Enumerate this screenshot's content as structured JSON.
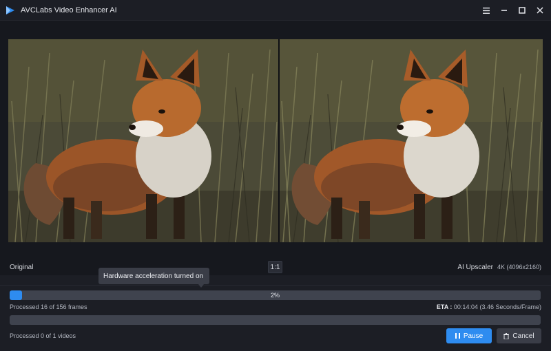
{
  "window": {
    "title": "AVCLabs Video Enhancer AI",
    "controls": [
      "menu-icon",
      "minimize-icon",
      "maximize-icon",
      "close-icon"
    ]
  },
  "preview": {
    "left_label": "Original",
    "ratio_label": "1:1",
    "model_label": "AI Upscaler",
    "resolution_label": "4K (4096x2160)"
  },
  "tooltip": {
    "text": "Hardware acceleration turned on"
  },
  "progress": {
    "percent_label": "2%",
    "fraction": 0.02,
    "frames_text": "Processed 16 of 156 frames",
    "eta_label": "ETA :",
    "eta_value": "00:14:04 (3.46 Seconds/Frame)"
  },
  "batch": {
    "fraction": 0,
    "videos_text": "Processed 0 of 1 videos"
  },
  "buttons": {
    "pause_label": "Pause",
    "cancel_label": "Cancel"
  },
  "colors": {
    "accent": "#2e8cf0",
    "background": "#1c1e25",
    "track": "#3f434e"
  }
}
